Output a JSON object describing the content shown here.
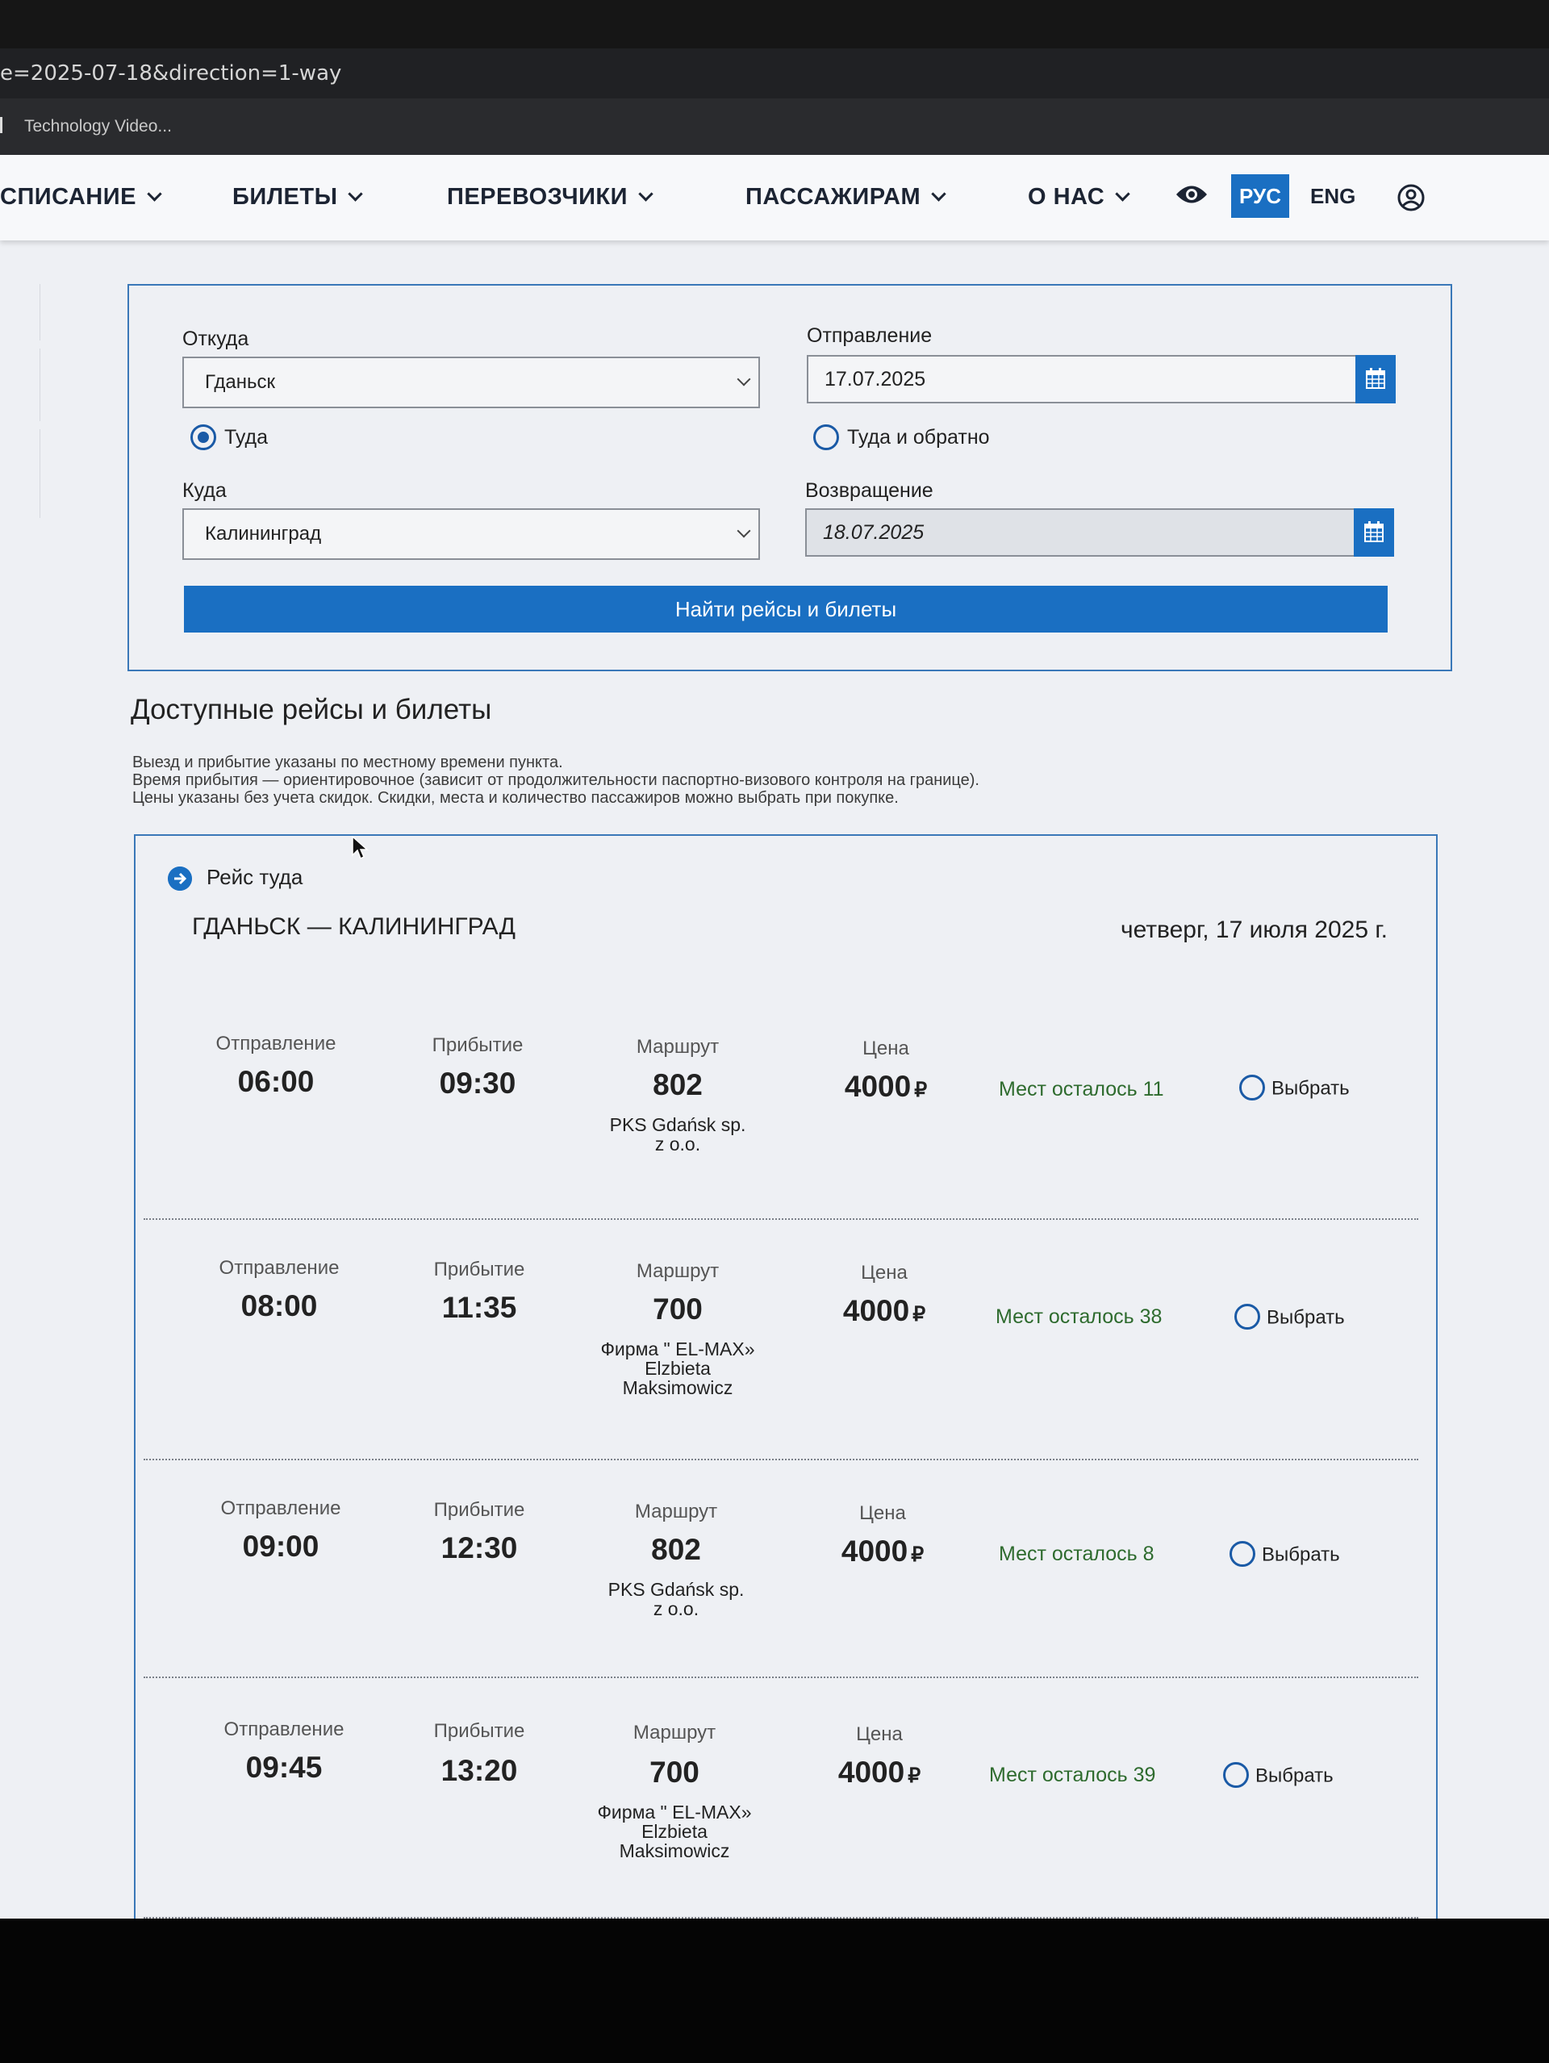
{
  "browser": {
    "url_fragment": "e=2025-07-18&direction=1-way",
    "bookmark_label": "Technology Video..."
  },
  "nav": {
    "items": [
      "СПИСАНИЕ",
      "БИЛЕТЫ",
      "ПЕРЕВОЗЧИКИ",
      "ПАССАЖИРАМ",
      "О НАС"
    ],
    "lang_ru": "РУС",
    "lang_en": "ENG"
  },
  "search": {
    "from_label": "Откуда",
    "from_value": "Гданьск",
    "to_label": "Куда",
    "to_value": "Калининград",
    "depart_label": "Отправление",
    "depart_value": "17.07.2025",
    "return_label": "Возвращение",
    "return_value": "18.07.2025",
    "oneway_label": "Туда",
    "roundtrip_label": "Туда и обратно",
    "submit_label": "Найти рейсы и билеты"
  },
  "results": {
    "heading": "Доступные рейсы и билеты",
    "note_1": "Выезд и прибытие указаны по местному времени пункта.",
    "note_2": "Время прибытия — ориентировочное (зависит от продолжительности паспортно-визового контроля на границе).",
    "note_3": "Цены указаны без учета скидок. Скидки, места и количество пассажиров можно выбрать при покупке.",
    "leg_label": "Рейс туда",
    "route": "ГДАНЬСК — КАЛИНИНГРАД",
    "date": "четверг, 17 июля 2025 г.",
    "col_depart": "Отправление",
    "col_arrive": "Прибытие",
    "col_route": "Маршрут",
    "col_price": "Цена",
    "currency": "₽",
    "select_label": "Выбрать",
    "trips": [
      {
        "depart": "06:00",
        "arrive": "09:30",
        "route": "802",
        "carrier_1": "PKS Gdańsk sp.",
        "carrier_2": "z o.o.",
        "carrier_3": "",
        "price": "4000",
        "seats": "Мест осталось 11"
      },
      {
        "depart": "08:00",
        "arrive": "11:35",
        "route": "700",
        "carrier_1": "Фирма \" EL-MAX»",
        "carrier_2": "Elzbieta",
        "carrier_3": "Maksimowicz",
        "price": "4000",
        "seats": "Мест осталось 38"
      },
      {
        "depart": "09:00",
        "arrive": "12:30",
        "route": "802",
        "carrier_1": "PKS Gdańsk sp.",
        "carrier_2": "z o.o.",
        "carrier_3": "",
        "price": "4000",
        "seats": "Мест осталось 8"
      },
      {
        "depart": "09:45",
        "arrive": "13:20",
        "route": "700",
        "carrier_1": "Фирма \" EL-MAX»",
        "carrier_2": "Elzbieta",
        "carrier_3": "Maksimowicz",
        "price": "4000",
        "seats": "Мест осталось 39"
      }
    ]
  }
}
